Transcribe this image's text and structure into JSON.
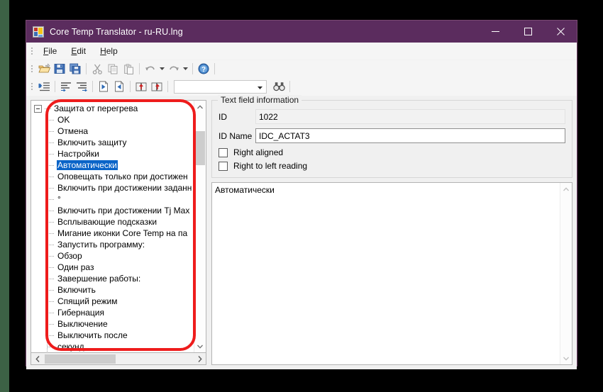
{
  "window": {
    "title": "Core Temp Translator - ru-RU.lng",
    "icon": "app-icon",
    "controls": {
      "minimize": "minimize",
      "maximize": "maximize",
      "close": "close"
    }
  },
  "menu": {
    "items": [
      {
        "label": "File",
        "mnemonic": "F"
      },
      {
        "label": "Edit",
        "mnemonic": "E"
      },
      {
        "label": "Help",
        "mnemonic": "H"
      }
    ]
  },
  "toolbar_primary": {
    "buttons": [
      {
        "name": "open-file-icon"
      },
      {
        "name": "save-icon"
      },
      {
        "name": "save-all-icon"
      },
      {
        "name": "cut-icon"
      },
      {
        "name": "copy-icon"
      },
      {
        "name": "paste-icon"
      },
      {
        "name": "undo-icon"
      },
      {
        "name": "redo-icon"
      },
      {
        "name": "help-icon"
      }
    ]
  },
  "toolbar_secondary": {
    "buttons": [
      {
        "name": "list-indent-icon"
      },
      {
        "name": "align-left-icon"
      },
      {
        "name": "align-right-icon"
      },
      {
        "name": "next-item-icon"
      },
      {
        "name": "previous-item-icon"
      },
      {
        "name": "book-import-icon"
      },
      {
        "name": "book-export-icon"
      }
    ],
    "search_combo_value": "",
    "find_icon": "binoculars-icon"
  },
  "tree": {
    "root": "Защита от перегрева",
    "items": [
      {
        "label": "OK",
        "selected": false
      },
      {
        "label": "Отмена",
        "selected": false
      },
      {
        "label": "Включить защиту",
        "selected": false
      },
      {
        "label": "Настройки",
        "selected": false
      },
      {
        "label": "Автоматически",
        "selected": true
      },
      {
        "label": "Оповещать только при достижен",
        "selected": false
      },
      {
        "label": "Включить при достижении заданн",
        "selected": false
      },
      {
        "label": "°",
        "selected": false
      },
      {
        "label": "Включить при достижении Tj Max",
        "selected": false
      },
      {
        "label": "Всплывающие подсказки",
        "selected": false
      },
      {
        "label": "Мигание иконки Core Temp на па",
        "selected": false
      },
      {
        "label": "Запустить программу:",
        "selected": false
      },
      {
        "label": "Обзор",
        "selected": false
      },
      {
        "label": "Один раз",
        "selected": false
      },
      {
        "label": "Завершение работы:",
        "selected": false
      },
      {
        "label": "Включить",
        "selected": false
      },
      {
        "label": "Спящий режим",
        "selected": false
      },
      {
        "label": "Гибернация",
        "selected": false
      },
      {
        "label": "Выключение",
        "selected": false
      },
      {
        "label": "Выключить после",
        "selected": false
      },
      {
        "label": "секунд",
        "selected": false
      }
    ]
  },
  "details": {
    "group_title": "Text field information",
    "id_label": "ID",
    "id_value": "1022",
    "id_name_label": "ID Name",
    "id_name_value": "IDC_ACTAT3",
    "right_aligned_label": "Right aligned",
    "right_to_left_label": "Right to left reading"
  },
  "editor": {
    "value": "Автоматически"
  },
  "colors": {
    "titlebar": "#5b2c5e",
    "selection": "#0a64c8",
    "annotation": "#ee1c1c",
    "desktop": "#000000"
  }
}
